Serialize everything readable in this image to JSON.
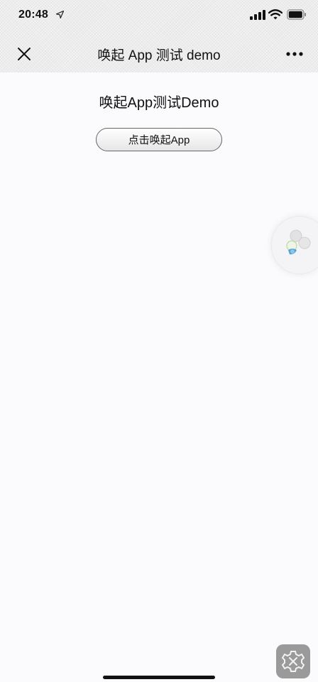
{
  "status_bar": {
    "time": "20:48",
    "icons": [
      "location-arrow-icon",
      "cellular-signal-icon",
      "wifi-icon",
      "battery-icon"
    ]
  },
  "nav_bar": {
    "title": "唤起 App 测试 demo",
    "close_icon": "close-icon",
    "more_icon": "more-icon"
  },
  "main": {
    "heading": "唤起App测试Demo",
    "launch_button_label": "点击唤起App"
  },
  "floating_widget": {
    "icon": "floating-assistant-icon"
  },
  "settings_button": {
    "icon": "gear-icon"
  },
  "colors": {
    "chrome_bg": "#ececec",
    "page_bg": "#fbfbfd",
    "text": "#111111",
    "button_border": "#666666",
    "settings_bg": "#9a9a9a"
  }
}
